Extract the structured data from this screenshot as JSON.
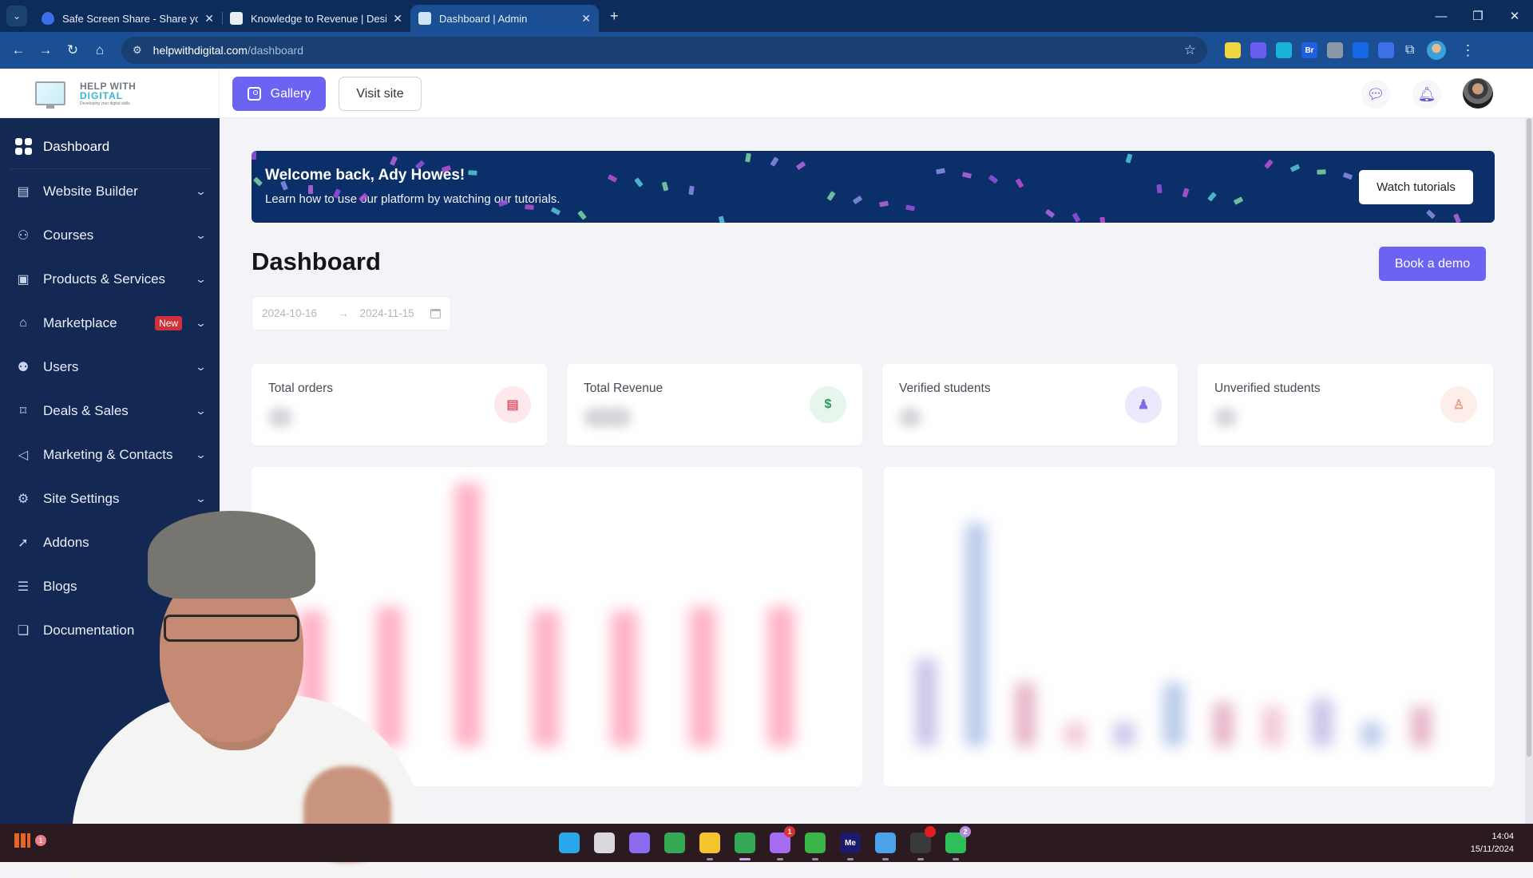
{
  "browser": {
    "tabs": [
      {
        "title": "Safe Screen Share - Share your",
        "favicon": "droplet-icon",
        "active": false
      },
      {
        "title": "Knowledge to Revenue | Design",
        "favicon": "site-icon",
        "active": false
      },
      {
        "title": "Dashboard | Admin",
        "favicon": "monitor-icon",
        "active": true
      }
    ],
    "url_domain": "helpwithdigital.com",
    "url_path": "/dashboard",
    "extensions": [
      {
        "name": "headset-extension",
        "label": "",
        "color": "#f2d640"
      },
      {
        "name": "flower-extension",
        "label": "",
        "color": "#6a5df0"
      },
      {
        "name": "flag-extension",
        "label": "",
        "color": "#18b4d8"
      },
      {
        "name": "br-extension",
        "label": "Br",
        "color": "#1f5fe0"
      },
      {
        "name": "camera-extension",
        "label": "",
        "color": "#8c97a8"
      },
      {
        "name": "refresh-extension",
        "label": "",
        "color": "#1468e8"
      },
      {
        "name": "droplet-extension",
        "label": "",
        "color": "#3d6fe6"
      }
    ]
  },
  "header": {
    "logo": {
      "line1": "HELP WITH",
      "line2": "DIGITAL",
      "tagline": "Developing your digital skills"
    },
    "gallery_label": "Gallery",
    "visit_site_label": "Visit site"
  },
  "sidebar": {
    "items": [
      {
        "label": "Dashboard",
        "icon": "dashboard-grid-icon",
        "expandable": false,
        "active": true
      },
      {
        "label": "Website Builder",
        "icon": "browser-layout-icon",
        "expandable": true
      },
      {
        "label": "Courses",
        "icon": "teacher-icon",
        "expandable": true
      },
      {
        "label": "Products & Services",
        "icon": "box-icon",
        "expandable": true
      },
      {
        "label": "Marketplace",
        "icon": "store-icon",
        "expandable": true,
        "badge": "New"
      },
      {
        "label": "Users",
        "icon": "users-icon",
        "expandable": true
      },
      {
        "label": "Deals & Sales",
        "icon": "price-tag-icon",
        "expandable": true
      },
      {
        "label": "Marketing & Contacts",
        "icon": "megaphone-icon",
        "expandable": true
      },
      {
        "label": "Site Settings",
        "icon": "settings-tools-icon",
        "expandable": true
      },
      {
        "label": "Addons",
        "icon": "addons-icon",
        "expandable": false
      },
      {
        "label": "Blogs",
        "icon": "blog-icon",
        "expandable": false
      },
      {
        "label": "Documentation",
        "icon": "documentation-icon",
        "expandable": false
      }
    ]
  },
  "banner": {
    "title": "Welcome back, Ady Howes!",
    "subtitle": "Learn how to use our platform by watching our tutorials.",
    "button_label": "Watch tutorials"
  },
  "main": {
    "title": "Dashboard",
    "book_demo_label": "Book a demo",
    "date_range": {
      "start": "2024-10-16",
      "separator": "→",
      "end": "2024-11-15"
    },
    "stats": [
      {
        "label": "Total orders",
        "icon": "orders-icon",
        "icon_glyph": "▤",
        "accent": "#e0596c",
        "accent_bg": "#fde8ec",
        "value_hidden": true
      },
      {
        "label": "Total Revenue",
        "icon": "dollar-icon",
        "icon_glyph": "$",
        "accent": "#2f9a56",
        "accent_bg": "#e6f6ec",
        "value_hidden": true
      },
      {
        "label": "Verified students",
        "icon": "verified-student-icon",
        "icon_glyph": "♟",
        "accent": "#7a6be6",
        "accent_bg": "#ece9fc",
        "value_hidden": true
      },
      {
        "label": "Unverified students",
        "icon": "unverified-student-icon",
        "icon_glyph": "♙",
        "accent": "#e49a82",
        "accent_bg": "#fdeeea",
        "value_hidden": true
      }
    ],
    "charts_note": "Both charts are blurred in the screenshot; values are not readable."
  },
  "chart_data": [
    {
      "type": "bar",
      "title": "",
      "obscured": true,
      "categories": [],
      "values": [],
      "color": "#ff8fab"
    },
    {
      "type": "bar",
      "title": "",
      "obscured": true,
      "categories": [],
      "series": []
    }
  ],
  "taskbar": {
    "apps": [
      {
        "name": "windows-start",
        "color": "#2aa7e8",
        "label": ""
      },
      {
        "name": "task-view",
        "color": "#d8d8de",
        "label": ""
      },
      {
        "name": "copilot",
        "color": "#8a6cf0",
        "label": ""
      },
      {
        "name": "chrome",
        "color": "#34a853",
        "label": ""
      },
      {
        "name": "file-explorer",
        "color": "#f4c430",
        "label": ""
      },
      {
        "name": "chrome-active",
        "color": "#34a853",
        "label": "",
        "running": true
      },
      {
        "name": "app-with-badge",
        "color": "#a56cf0",
        "label": "",
        "badge": "1",
        "badge_color": "#d93030"
      },
      {
        "name": "camtasia",
        "color": "#3bb54a",
        "label": ""
      },
      {
        "name": "media-encoder",
        "color": "#1d1a6b",
        "label": "Me"
      },
      {
        "name": "notepad",
        "color": "#4aa3e8",
        "label": ""
      },
      {
        "name": "obs",
        "color": "#3a3a3a",
        "label": "",
        "badge": "",
        "badge_color": "#e02020"
      },
      {
        "name": "whatsapp",
        "color": "#2dbf5a",
        "label": "",
        "badge": "2",
        "badge_color": "#b98be0"
      }
    ],
    "time": "14:04",
    "date": "15/11/2024",
    "tray_badge": "1"
  }
}
